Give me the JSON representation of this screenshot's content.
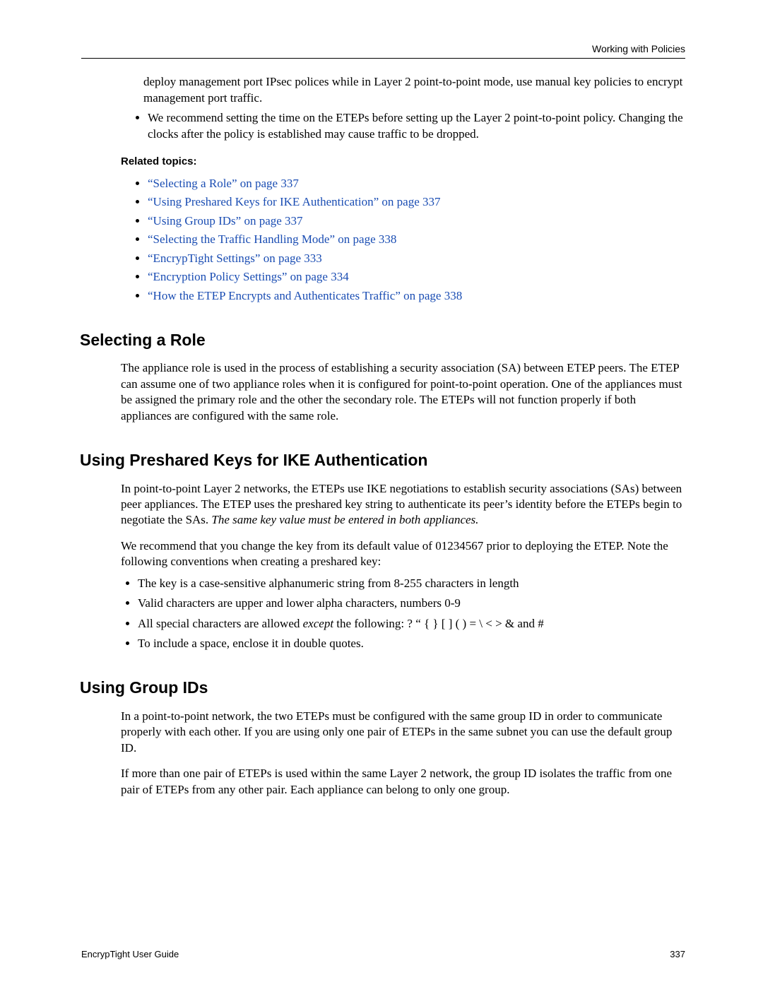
{
  "header": {
    "right": "Working with Policies"
  },
  "intro": {
    "continued": "deploy management port IPsec polices while in Layer 2 point-to-point mode, use manual key policies to encrypt management port traffic.",
    "bullet": "We recommend setting the time on the ETEPs before setting up the Layer 2 point-to-point policy. Changing the clocks after the policy is established may cause traffic to be dropped."
  },
  "related": {
    "heading": "Related topics:",
    "links": [
      "“Selecting a Role” on page 337",
      "“Using Preshared Keys for IKE Authentication” on page 337",
      "“Using Group IDs” on page 337",
      "“Selecting the Traffic Handling Mode” on page 338",
      "“EncrypTight Settings” on page 333",
      "“Encryption Policy Settings” on page 334",
      "“How the ETEP Encrypts and Authenticates Traffic” on page 338"
    ]
  },
  "sections": {
    "selecting_role": {
      "title": "Selecting a Role",
      "p1": "The appliance role is used in the process of establishing a security association (SA) between ETEP peers. The ETEP can assume one of two appliance roles when it is configured for point-to-point operation. One of the appliances must be assigned the primary role and the other the secondary role. The ETEPs will not function properly if both appliances are configured with the same role."
    },
    "preshared": {
      "title": "Using Preshared Keys for IKE Authentication",
      "p1a": "In point-to-point Layer 2 networks, the ETEPs use IKE negotiations to establish security associations (SAs) between peer appliances. The ETEP uses the preshared key string to authenticate its peer’s identity before the ETEPs begin to negotiate the SAs. ",
      "p1b": "The same key value must be entered in both appliances.",
      "p2": "We recommend that you change the key from its default value of 01234567 prior to deploying the ETEP. Note the following conventions when creating a preshared key:",
      "bullets": {
        "b1": "The key is a case-sensitive alphanumeric string from 8-255 characters in length",
        "b2": "Valid characters are upper and lower alpha characters, numbers 0-9",
        "b3a": "All special characters are allowed ",
        "b3b": "except",
        "b3c": " the following: ? “ { } [ ] ( ) = \\ < > & and #",
        "b4": "To include a space, enclose it in double quotes."
      }
    },
    "group_ids": {
      "title": "Using Group IDs",
      "p1": "In a point-to-point network, the two ETEPs must be configured with the same group ID in order to communicate properly with each other. If you are using only one pair of ETEPs in the same subnet you can use the default group ID.",
      "p2": "If more than one pair of ETEPs is used within the same Layer 2 network, the group ID isolates the traffic from one pair of ETEPs from any other pair. Each appliance can belong to only one group."
    }
  },
  "footer": {
    "left": "EncrypTight User Guide",
    "right": "337"
  }
}
